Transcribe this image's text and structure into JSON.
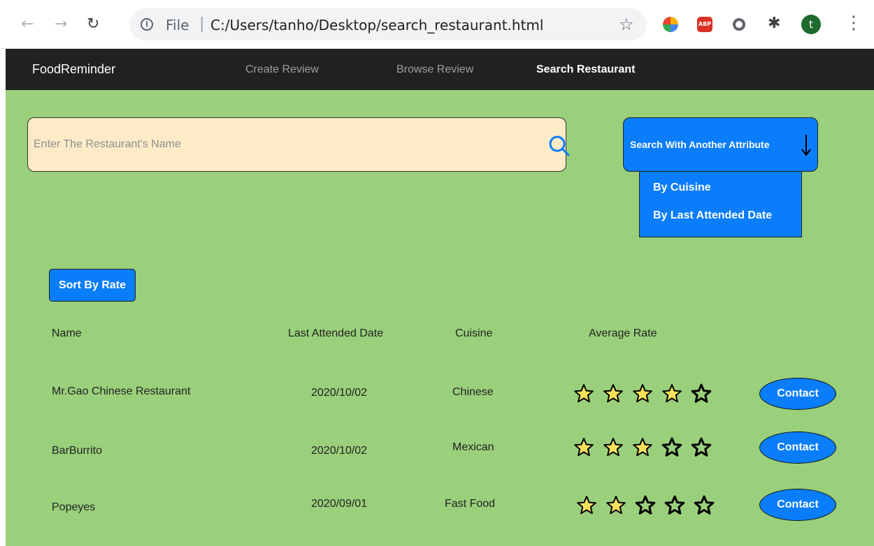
{
  "browser": {
    "url_scheme": "File",
    "url_separator": "|",
    "url": "C:/Users/tanho/Desktop/search_restaurant.html",
    "abp_label": "ABP",
    "profile_initial": "t"
  },
  "navbar": {
    "brand": "FoodReminder",
    "links": [
      {
        "label": "Create Review",
        "active": false
      },
      {
        "label": "Browse Review",
        "active": false
      },
      {
        "label": "Search Restaurant",
        "active": true
      }
    ]
  },
  "search": {
    "placeholder": "Enter The Restaurant's Name",
    "value": ""
  },
  "attribute_search": {
    "label": "Search With Another Attribute",
    "options": [
      "By Cuisine",
      "By Last Attended Date"
    ]
  },
  "sort_button": "Sort By Rate",
  "table": {
    "headers": [
      "Name",
      "Last Attended Date",
      "Cuisine",
      "Average Rate"
    ],
    "rows": [
      {
        "name": "Mr.Gao Chinese Restaurant",
        "date": "2020/10/02",
        "cuisine": "Chinese",
        "rating": 4,
        "max_rating": 5,
        "action": "Contact"
      },
      {
        "name": "BarBurrito",
        "date": "2020/10/02",
        "cuisine": "Mexican",
        "rating": 3,
        "max_rating": 5,
        "action": "Contact"
      },
      {
        "name": "Popeyes",
        "date": "2020/09/01",
        "cuisine": "Fast Food",
        "rating": 2,
        "max_rating": 5,
        "action": "Contact"
      }
    ]
  },
  "colors": {
    "page_background": "#9ad07b",
    "navbar_background": "#212121",
    "accent_blue": "#0a7dfb",
    "search_background": "#fdebc8",
    "star_filled": "#f7e15a"
  }
}
